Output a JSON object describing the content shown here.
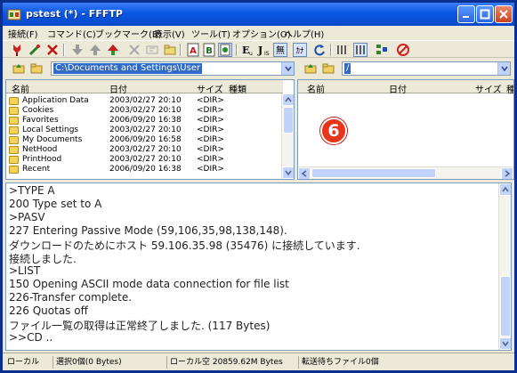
{
  "window": {
    "title": "pstest (*) - FFFTP"
  },
  "menu": [
    "接続(F)",
    "コマンド(C)",
    "ブックマーク(B)",
    "表示(V)",
    "ツール(T)",
    "オプション(O)",
    "ヘルプ(H)"
  ],
  "local": {
    "path": "C:\\Documents and Settings\\User",
    "columns": {
      "name": "名前",
      "date": "日付",
      "size": "サイズ",
      "type": "種類"
    },
    "rows": [
      {
        "name": "Application Data",
        "date": "2003/02/27 20:10",
        "size": "<DIR>"
      },
      {
        "name": "Cookies",
        "date": "2003/02/27 20:10",
        "size": "<DIR>"
      },
      {
        "name": "Favorites",
        "date": "2006/09/20 16:38",
        "size": "<DIR>"
      },
      {
        "name": "Local Settings",
        "date": "2003/02/27 20:10",
        "size": "<DIR>"
      },
      {
        "name": "My Documents",
        "date": "2006/09/20 16:58",
        "size": "<DIR>"
      },
      {
        "name": "NetHood",
        "date": "2003/02/27 20:10",
        "size": "<DIR>"
      },
      {
        "name": "PrintHood",
        "date": "2003/02/27 20:10",
        "size": "<DIR>"
      },
      {
        "name": "Recent",
        "date": "2006/09/20 16:38",
        "size": "<DIR>"
      }
    ]
  },
  "remote": {
    "path": "/",
    "columns": {
      "name": "名前",
      "date": "日付",
      "size": "サイズ",
      "type": "種"
    },
    "badge": "6"
  },
  "log": [
    ">TYPE A",
    "200 Type set to A",
    ">PASV",
    "227 Entering Passive Mode (59,106,35,98,138,148).",
    "ダウンロードのためにホスト 59.106.35.98 (35476) に接続しています.",
    "接続しました.",
    ">LIST",
    "150 Opening ASCII mode data connection for file list",
    "226-Transfer complete.",
    "226 Quotas off",
    "ファイル一覧の取得は正常終了しました. (117 Bytes)",
    ">>CD .."
  ],
  "status": {
    "local": "ローカル",
    "selected": "選択0個(0 Bytes)",
    "free": "ローカル空 20859.62M Bytes",
    "queue": "転送待ちファイル0個"
  },
  "toolbar_text": {
    "e": "E",
    "j": "J",
    "mu": "無",
    "ka": "ｶﾅ"
  },
  "colors": {
    "titlebar": "#0a57e5",
    "selection": "#316ac5",
    "badge": "#e8341c"
  }
}
